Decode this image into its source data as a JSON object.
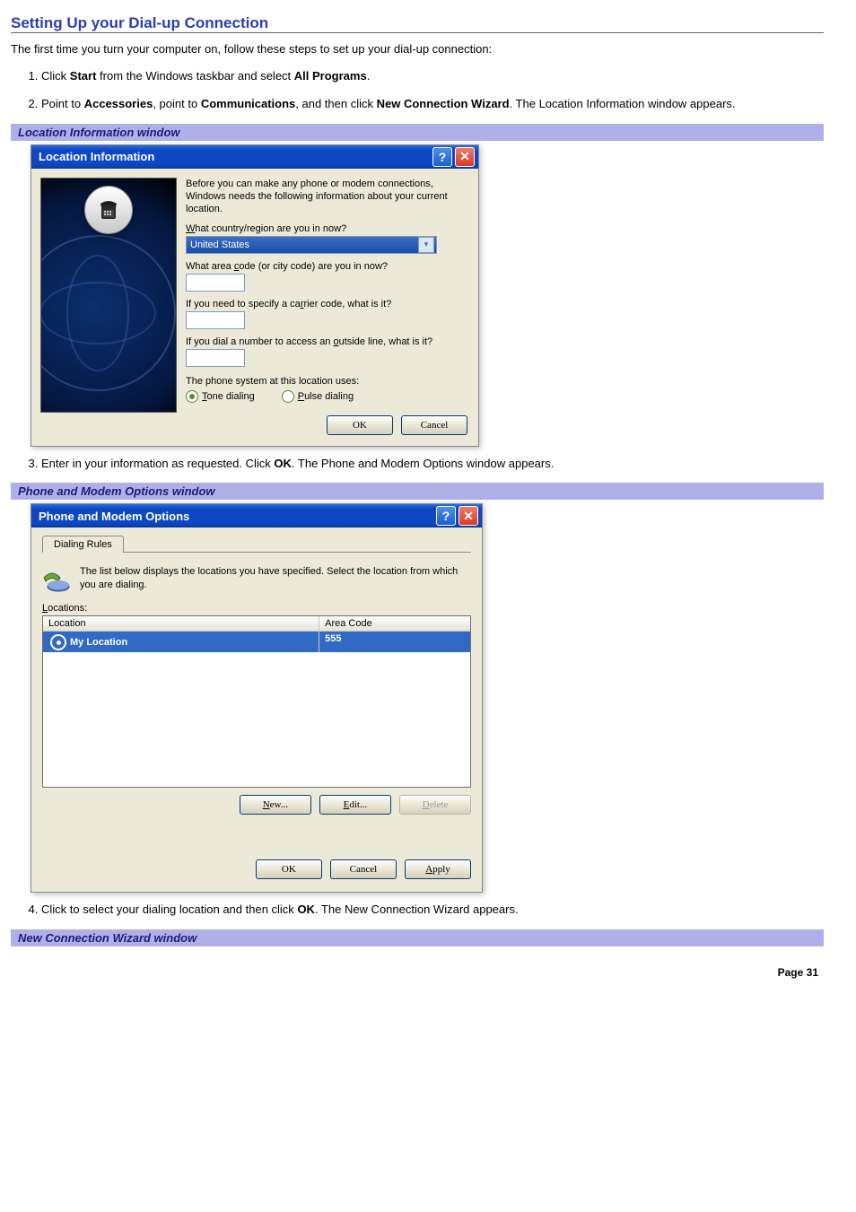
{
  "section_title": "Setting Up your Dial-up Connection",
  "intro": "The first time you turn your computer on, follow these steps to set up your dial-up connection:",
  "steps": {
    "s1_pre": "Click ",
    "s1_b1": "Start",
    "s1_mid": " from the Windows taskbar and select ",
    "s1_b2": "All Programs",
    "s1_end": ".",
    "s2_pre": "Point to ",
    "s2_b1": "Accessories",
    "s2_m1": ", point to ",
    "s2_b2": "Communications",
    "s2_m2": ", and then click ",
    "s2_b3": "New Connection Wizard",
    "s2_end": ". The Location Information window appears.",
    "s3_pre": "Enter in your information as requested. Click ",
    "s3_b1": "OK",
    "s3_end": ". The Phone and Modem Options window appears.",
    "s4_pre": "Click to select your dialing location and then click ",
    "s4_b1": "OK",
    "s4_end": ". The New Connection Wizard appears."
  },
  "captions": {
    "loc": "Location Information window",
    "pm": "Phone and Modem Options window",
    "ncw": "New Connection Wizard window"
  },
  "loc_dialog": {
    "title": "Location Information",
    "help_glyph": "?",
    "close_glyph": "✕",
    "intro": "Before you can make any phone or modem connections, Windows needs the following information about your current location.",
    "q_country_pre": "W",
    "q_country_rest": "hat country/region are you in now?",
    "country_value": "United States",
    "q_area_pre": "What area ",
    "q_area_u": "c",
    "q_area_rest": "ode (or city code) are you in now?",
    "q_carrier_pre": "If you need to specify a ca",
    "q_carrier_u": "r",
    "q_carrier_rest": "rier code, what is it?",
    "q_outside_pre": "If you dial a number to access an ",
    "q_outside_u": "o",
    "q_outside_rest": "utside line, what is it?",
    "phone_system": "The phone system at this location uses:",
    "tone_u": "T",
    "tone_rest": "one dialing",
    "pulse_u": "P",
    "pulse_rest": "ulse dialing",
    "ok": "OK",
    "cancel": "Cancel"
  },
  "pm_dialog": {
    "title": "Phone and Modem Options",
    "tab": "Dialing Rules",
    "desc": "The list below displays the locations you have specified. Select the location from which you are dialing.",
    "locations_u": "L",
    "locations_rest": "ocations:",
    "col_location": "Location",
    "col_areacode": "Area Code",
    "row_name": "My Location",
    "row_area": "555",
    "btn_new_u": "N",
    "btn_new_rest": "ew...",
    "btn_edit_u": "E",
    "btn_edit_rest": "dit...",
    "btn_delete_u": "D",
    "btn_delete_rest": "elete",
    "ok": "OK",
    "cancel": "Cancel",
    "apply_u": "A",
    "apply_rest": "pply"
  },
  "footer": "Page 31"
}
